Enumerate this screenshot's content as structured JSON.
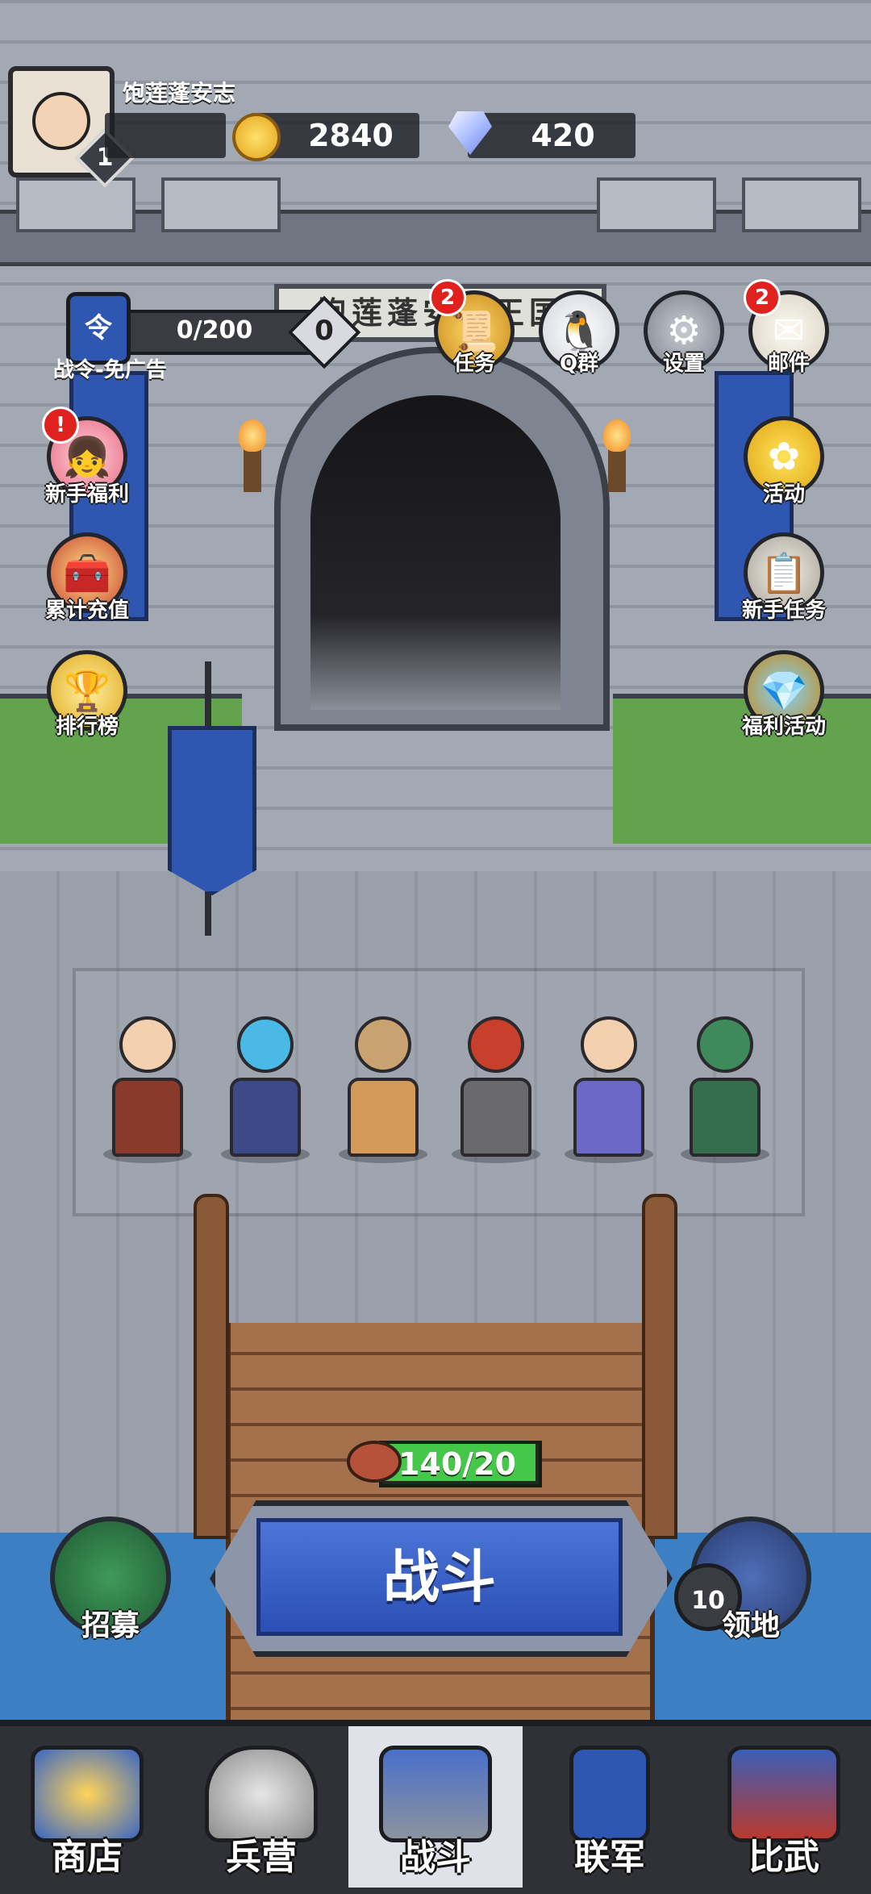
{
  "player": {
    "name": "饱莲蓬安志",
    "level": "1"
  },
  "resources": {
    "gold": "2840",
    "diamonds": "420"
  },
  "battle_pass": {
    "progress": "0/200",
    "points": "0",
    "label": "战令-免广告",
    "icon_char": "令"
  },
  "gate_sign": "饱莲蓬安志王国",
  "top_buttons": [
    {
      "label": "任务",
      "badge": "2",
      "icon": "scroll-icon"
    },
    {
      "label": "Q群",
      "badge": "",
      "icon": "penguin-icon"
    },
    {
      "label": "设置",
      "badge": "",
      "icon": "gear-icon"
    },
    {
      "label": "邮件",
      "badge": "2",
      "icon": "mail-icon"
    }
  ],
  "left_buttons": [
    {
      "label": "新手福利",
      "badge": "!",
      "icon": "girl-portrait-icon"
    },
    {
      "label": "累计充值",
      "icon": "treasure-chest-icon"
    },
    {
      "label": "排行榜",
      "icon": "trophy-icon"
    }
  ],
  "right_buttons": [
    {
      "label": "活动",
      "icon": "flower-icon"
    },
    {
      "label": "新手任务",
      "icon": "notice-board-icon"
    },
    {
      "label": "福利活动",
      "icon": "gem-pot-icon"
    }
  ],
  "stamina": {
    "text": "140/20",
    "icon": "meat-icon"
  },
  "battle_button": "战斗",
  "recruit_button": "招募",
  "territory": {
    "label": "领地",
    "count": "10"
  },
  "nav": [
    {
      "label": "商店",
      "icon": "coin-shop-icon",
      "active": false
    },
    {
      "label": "兵营",
      "icon": "helmet-icon",
      "active": false
    },
    {
      "label": "战斗",
      "icon": "castle-icon",
      "active": true
    },
    {
      "label": "联军",
      "icon": "banner-icon",
      "active": false
    },
    {
      "label": "比武",
      "icon": "arena-icon",
      "active": false
    }
  ],
  "colors": {
    "accent_blue": "#2b4fb5",
    "badge_red": "#e0211d",
    "stamina_green": "#45c84a"
  }
}
